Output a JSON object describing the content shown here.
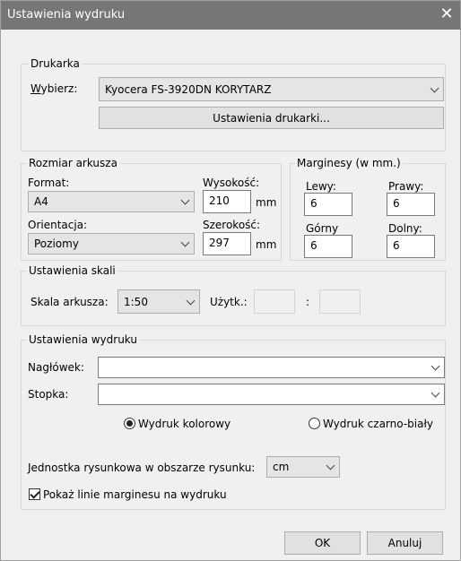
{
  "window": {
    "title": "Ustawienia wydruku",
    "close_glyph": "✕"
  },
  "printer": {
    "legend": "Drukarka",
    "select_label": "Wybierz:",
    "selected_printer": "Kyocera FS-3920DN KORYTARZ",
    "settings_button": "Ustawienia drukarki..."
  },
  "sheet": {
    "legend": "Rozmiar arkusza",
    "format_label": "Format:",
    "format_value": "A4",
    "orientation_label": "Orientacja:",
    "orientation_value": "Poziomy",
    "height_label": "Wysokość:",
    "height_value": "210",
    "height_unit": "mm",
    "width_label": "Szerokość:",
    "width_value": "297",
    "width_unit": "mm"
  },
  "margins": {
    "legend": "Marginesy (w mm.)",
    "left_label": "Lewy:",
    "left_value": "6",
    "right_label": "Prawy:",
    "right_value": "6",
    "top_label": "Górny",
    "top_value": "6",
    "bottom_label": "Dolny:",
    "bottom_value": "6"
  },
  "scale": {
    "legend": "Ustawienia skali",
    "sheet_scale_label": "Skala arkusza:",
    "sheet_scale_value": "1:50",
    "user_label": "Użytk.:",
    "separator": ":"
  },
  "print": {
    "legend": "Ustawienia wydruku",
    "header_label": "Nagłówek:",
    "header_value": "",
    "footer_label": "Stopka:",
    "footer_value": "",
    "color_label": "Wydruk kolorowy",
    "bw_label": "Wydruk czarno-biały",
    "unit_label": "Jednostka rysunkowa w obszarze rysunku:",
    "unit_value": "cm",
    "show_margin_label": "Pokaż linie marginesu na wydruku",
    "color_selected": true,
    "show_margin_checked": true
  },
  "buttons": {
    "ok": "OK",
    "cancel": "Anuluj"
  }
}
